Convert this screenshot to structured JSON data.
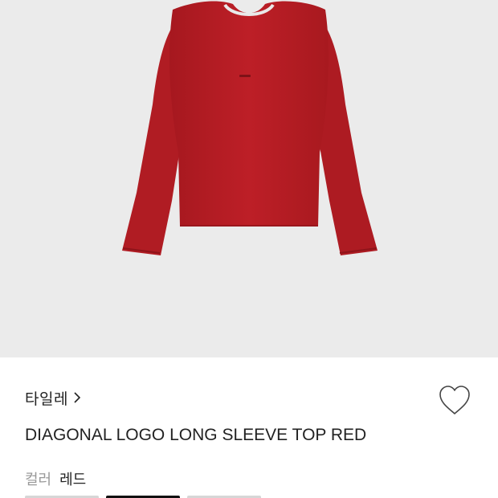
{
  "product": {
    "brand": "타일레",
    "title": "DIAGONAL LOGO LONG SLEEVE TOP RED",
    "color_label": "컬러",
    "color_value": "레드",
    "image_color": "#b81d24"
  },
  "icons": {
    "brand_link": "chevron-right-icon",
    "wishlist": "heart-outline-icon"
  },
  "colors": {
    "hero_background": "#ebebeb",
    "text_primary": "#222222",
    "text_secondary": "#999999"
  }
}
